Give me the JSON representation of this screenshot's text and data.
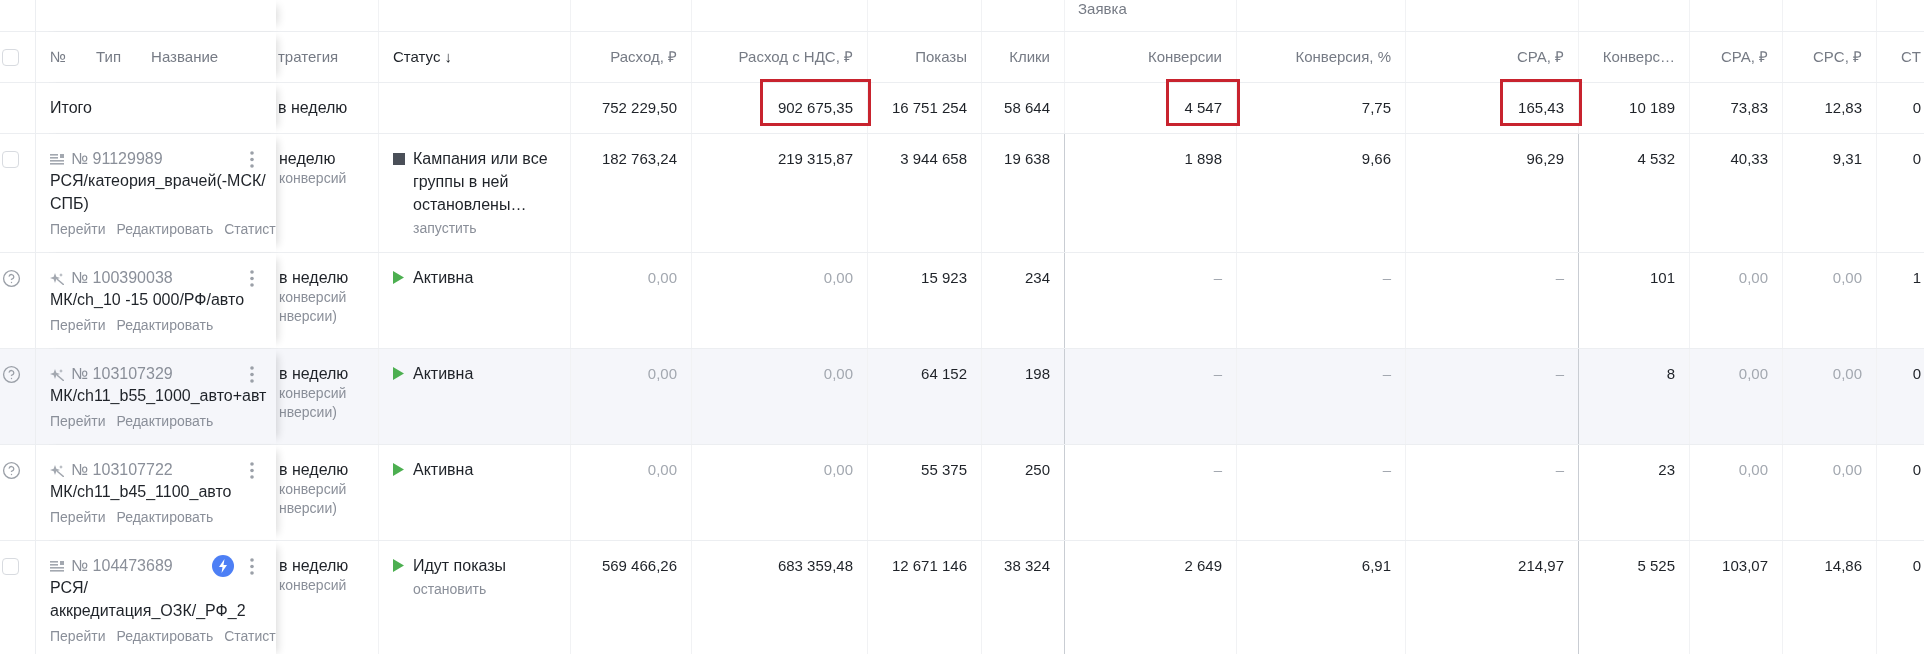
{
  "group_header": "Заявка",
  "header": {
    "select_all": {
      "checked": false
    },
    "frozen_labels": [
      "№",
      "Тип",
      "Название"
    ],
    "strategy": "тратегия",
    "status": "Статус ↓",
    "metrics": [
      "Расход, ₽",
      "Расход с НДС, ₽",
      "Показы",
      "Клики",
      "Конверсии",
      "Конверсия, %",
      "CPA, ₽",
      "Конверс…",
      "CPA, ₽",
      "CPC, ₽",
      "CT"
    ]
  },
  "totals": {
    "label": "Итого",
    "strategy": "в неделю",
    "values": [
      {
        "text": "752 229,50",
        "boxed": false
      },
      {
        "text": "902 675,35",
        "boxed": true
      },
      {
        "text": "16 751 254",
        "boxed": false
      },
      {
        "text": "58 644",
        "boxed": false
      },
      {
        "text": "4 547",
        "boxed": true
      },
      {
        "text": "7,75",
        "boxed": false
      },
      {
        "text": "165,43",
        "boxed": true
      },
      {
        "text": "10 189",
        "boxed": false
      },
      {
        "text": "73,83",
        "boxed": false
      },
      {
        "text": "12,83",
        "boxed": false
      },
      {
        "text": "0",
        "boxed": false
      }
    ]
  },
  "rows": [
    {
      "hovered": false,
      "selector": {
        "kind": "checkbox",
        "checked": false
      },
      "kind": "network",
      "number": "№ 91129989",
      "boost_badge": false,
      "name": "РСЯ/катеория_врачей(-МСК/СПБ)",
      "links": [
        "Перейти",
        "Редактировать",
        "Статист"
      ],
      "strategy": [
        "неделю",
        "конверсий"
      ],
      "status": {
        "kind": "stopped",
        "text": "Кампания или все группы в ней остановлены…",
        "action": "запустить"
      },
      "values": [
        {
          "text": "182 763,24",
          "dimmed": false
        },
        {
          "text": "219 315,87",
          "dimmed": false
        },
        {
          "text": "3 944 658",
          "dimmed": false
        },
        {
          "text": "19 638",
          "dimmed": false
        },
        {
          "text": "1 898",
          "dimmed": false
        },
        {
          "text": "9,66",
          "dimmed": false
        },
        {
          "text": "96,29",
          "dimmed": false
        },
        {
          "text": "4 532",
          "dimmed": false
        },
        {
          "text": "40,33",
          "dimmed": false
        },
        {
          "text": "9,31",
          "dimmed": false
        },
        {
          "text": "0",
          "dimmed": false
        }
      ]
    },
    {
      "hovered": false,
      "selector": {
        "kind": "help"
      },
      "kind": "master",
      "number": "№ 100390038",
      "boost_badge": false,
      "name": "МК/ch_10 -15 000/РФ/авто",
      "links": [
        "Перейти",
        "Редактировать"
      ],
      "strategy": [
        "в неделю",
        "конверсий",
        "нверсии)"
      ],
      "status": {
        "kind": "active",
        "text": "Активна"
      },
      "values": [
        {
          "text": "0,00",
          "dimmed": true
        },
        {
          "text": "0,00",
          "dimmed": true
        },
        {
          "text": "15 923",
          "dimmed": false
        },
        {
          "text": "234",
          "dimmed": false
        },
        {
          "text": "–",
          "dimmed": true
        },
        {
          "text": "–",
          "dimmed": true
        },
        {
          "text": "–",
          "dimmed": true
        },
        {
          "text": "101",
          "dimmed": false
        },
        {
          "text": "0,00",
          "dimmed": true
        },
        {
          "text": "0,00",
          "dimmed": true
        },
        {
          "text": "1",
          "dimmed": false
        }
      ]
    },
    {
      "hovered": true,
      "selector": {
        "kind": "help"
      },
      "kind": "master",
      "number": "№ 103107329",
      "boost_badge": false,
      "name": "МК/ch11_b55_1000_авто+авт",
      "links": [
        "Перейти",
        "Редактировать"
      ],
      "strategy": [
        "в неделю",
        "конверсий",
        "нверсии)"
      ],
      "status": {
        "kind": "active",
        "text": "Активна"
      },
      "values": [
        {
          "text": "0,00",
          "dimmed": true
        },
        {
          "text": "0,00",
          "dimmed": true
        },
        {
          "text": "64 152",
          "dimmed": false
        },
        {
          "text": "198",
          "dimmed": false
        },
        {
          "text": "–",
          "dimmed": true
        },
        {
          "text": "–",
          "dimmed": true
        },
        {
          "text": "–",
          "dimmed": true
        },
        {
          "text": "8",
          "dimmed": false
        },
        {
          "text": "0,00",
          "dimmed": true
        },
        {
          "text": "0,00",
          "dimmed": true
        },
        {
          "text": "0",
          "dimmed": false
        }
      ]
    },
    {
      "hovered": false,
      "selector": {
        "kind": "help"
      },
      "kind": "master",
      "number": "№ 103107722",
      "boost_badge": false,
      "name": "МК/ch11_b45_1100_авто",
      "links": [
        "Перейти",
        "Редактировать"
      ],
      "strategy": [
        "в неделю",
        "конверсий",
        "нверсии)"
      ],
      "status": {
        "kind": "active",
        "text": "Активна"
      },
      "values": [
        {
          "text": "0,00",
          "dimmed": true
        },
        {
          "text": "0,00",
          "dimmed": true
        },
        {
          "text": "55 375",
          "dimmed": false
        },
        {
          "text": "250",
          "dimmed": false
        },
        {
          "text": "–",
          "dimmed": true
        },
        {
          "text": "–",
          "dimmed": true
        },
        {
          "text": "–",
          "dimmed": true
        },
        {
          "text": "23",
          "dimmed": false
        },
        {
          "text": "0,00",
          "dimmed": true
        },
        {
          "text": "0,00",
          "dimmed": true
        },
        {
          "text": "0",
          "dimmed": false
        }
      ]
    },
    {
      "hovered": false,
      "selector": {
        "kind": "checkbox",
        "checked": false
      },
      "kind": "network",
      "number": "№ 104473689",
      "boost_badge": true,
      "name": "РСЯ/аккредитация_ОЗК/_РФ_2",
      "links": [
        "Перейти",
        "Редактировать",
        "Статист"
      ],
      "strategy": [
        "в неделю",
        "конверсий"
      ],
      "status": {
        "kind": "active",
        "text": "Идут показы",
        "action": "остановить"
      },
      "values": [
        {
          "text": "569 466,26",
          "dimmed": false
        },
        {
          "text": "683 359,48",
          "dimmed": false
        },
        {
          "text": "12 671 146",
          "dimmed": false
        },
        {
          "text": "38 324",
          "dimmed": false
        },
        {
          "text": "2 649",
          "dimmed": false
        },
        {
          "text": "6,91",
          "dimmed": false
        },
        {
          "text": "214,97",
          "dimmed": false
        },
        {
          "text": "5 525",
          "dimmed": false
        },
        {
          "text": "103,07",
          "dimmed": false
        },
        {
          "text": "14,86",
          "dimmed": false
        },
        {
          "text": "0",
          "dimmed": false
        }
      ]
    }
  ]
}
